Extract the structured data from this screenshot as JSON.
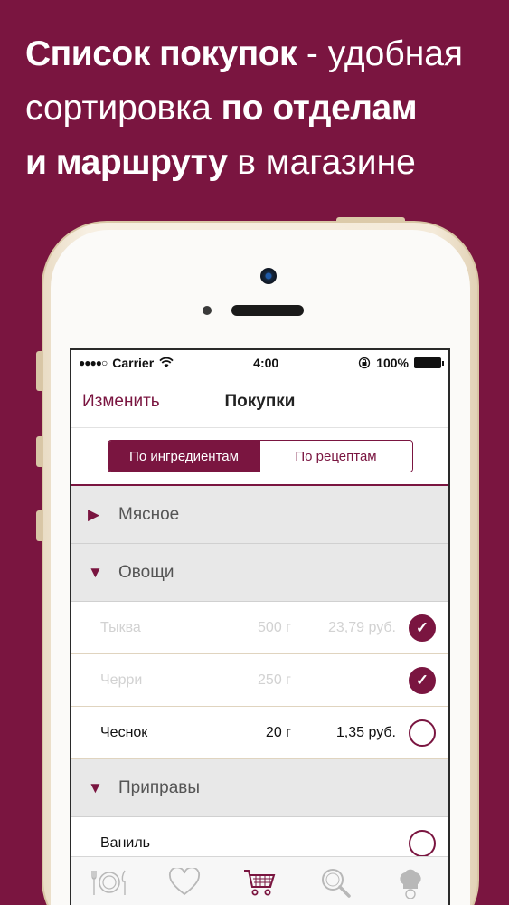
{
  "headline": {
    "line1_bold": "Список покупок",
    "line1_light": " - удобная",
    "line2_light": "сортировка ",
    "line2_bold": "по отделам",
    "line3_bold": "и маршруту",
    "line3_light": " в магазине"
  },
  "status_bar": {
    "signal": "●●●●○",
    "carrier": "Carrier",
    "time": "4:00",
    "battery": "100%"
  },
  "nav": {
    "edit_label": "Изменить",
    "title": "Покупки"
  },
  "segments": {
    "by_ingredients": "По ингредиентам",
    "by_recipes": "По рецептам",
    "selected": "by_ingredients"
  },
  "sections": [
    {
      "name": "Мясное",
      "state": "collapsed",
      "arrow": "▶"
    },
    {
      "name": "Овощи",
      "state": "expanded",
      "arrow": "▼"
    },
    {
      "name": "Приправы",
      "state": "expanded",
      "arrow": "▼"
    }
  ],
  "items": [
    {
      "name": "Тыква",
      "qty": "500 г",
      "price": "23,79 руб.",
      "checked": true
    },
    {
      "name": "Черри",
      "qty": "250 г",
      "price": "",
      "checked": true
    },
    {
      "name": "Чеснок",
      "qty": "20 г",
      "price": "1,35 руб.",
      "checked": false
    },
    {
      "name": "Ваниль",
      "qty": "",
      "price": "",
      "checked": false
    }
  ],
  "tabs": [
    {
      "icon": "plate-cutlery-icon",
      "active": false
    },
    {
      "icon": "heart-icon",
      "active": false
    },
    {
      "icon": "shopping-cart-icon",
      "active": true
    },
    {
      "icon": "search-icon",
      "active": false
    },
    {
      "icon": "chef-hat-icon",
      "active": false
    }
  ],
  "colors": {
    "background": "#7a1540",
    "accent": "#7a1540",
    "phone_frame": "#f4ead9"
  }
}
